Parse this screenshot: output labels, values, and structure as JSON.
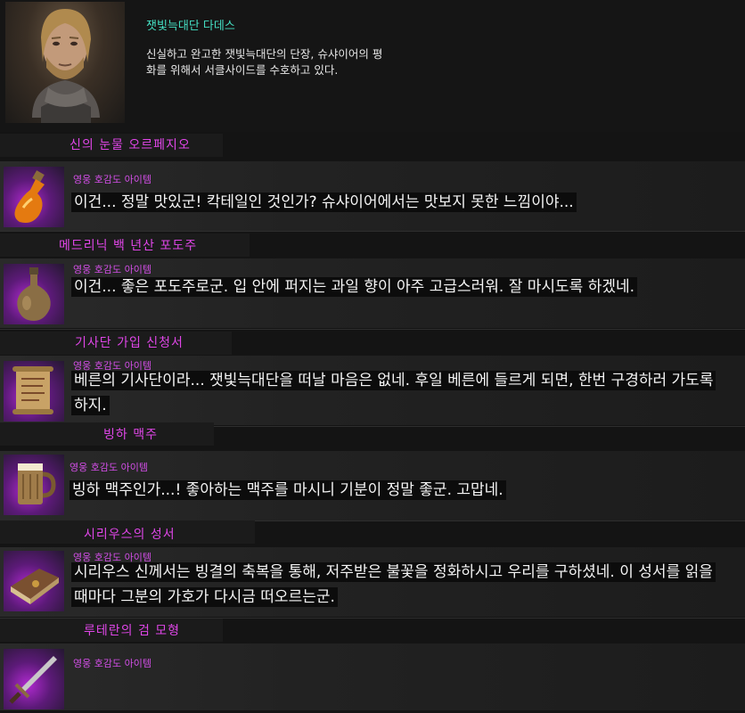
{
  "npc": {
    "name": "잿빛늑대단 다데스",
    "description": "신실하고 완고한 잿빛늑대단의 단장, 슈샤이어의 평화를 위해서 서클사이드를 수호하고 있다."
  },
  "items": [
    {
      "title": "신의 눈물 오르페지오",
      "grade": "영웅 호감도 아이템",
      "icon": "potion-bottle-icon",
      "dialog": "이건... 정말 맛있군! 칵테일인 것인가? 슈샤이어에서는 맛보지 못한 느낌이야..."
    },
    {
      "title": "메드리닉 백 년산 포도주",
      "grade": "영웅 호감도 아이템",
      "icon": "wine-flask-icon",
      "dialog": "이건... 좋은 포도주로군. 입 안에 퍼지는 과일 향이 아주 고급스러워. 잘 마시도록 하겠네."
    },
    {
      "title": "기사단 가입 신청서",
      "grade": "영웅 호감도 아이템",
      "icon": "scroll-icon",
      "dialog": "베른의 기사단이라... 잿빛늑대단을 떠날 마음은 없네. 후일 베른에 들르게 되면, 한번 구경하러 가도록 하지."
    },
    {
      "title": "빙하 맥주",
      "grade": "영웅 호감도 아이템",
      "icon": "beer-mug-icon",
      "dialog": "빙하 맥주인가...! 좋아하는 맥주를 마시니 기분이 정말 좋군. 고맙네."
    },
    {
      "title": "시리우스의 성서",
      "grade": "영웅 호감도 아이템",
      "icon": "holy-book-icon",
      "dialog": "시리우스 신께서는 빙결의 축복을 통해, 저주받은 불꽃을 정화하시고 우리를 구하셨네. 이 성서를 읽을 때마다 그분의 가호가 다시금 떠오르는군."
    },
    {
      "title": "루테란의 검 모형",
      "grade": "영웅 호감도 아이템",
      "icon": "sword-model-icon",
      "dialog": ""
    }
  ]
}
